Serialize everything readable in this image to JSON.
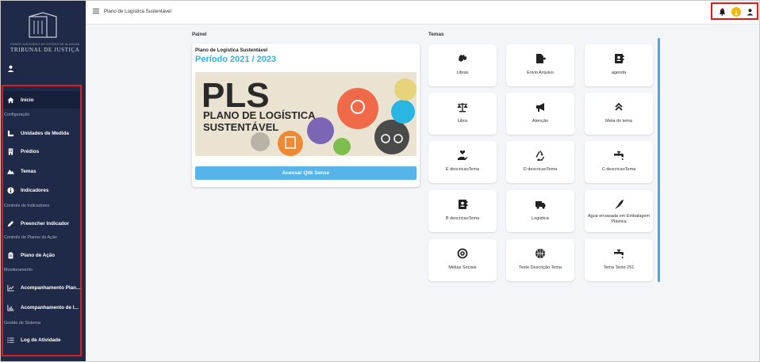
{
  "app": {
    "page_title": "Plano de Logística Sustentável"
  },
  "logo": {
    "subtitle": "PODER JUDICIÁRIO DO ESTADO DE ALAGOAS",
    "title": "TRIBUNAL DE JUSTIÇA"
  },
  "sidebar": {
    "items": [
      {
        "label": "Início",
        "icon": "home-icon"
      },
      {
        "section": "Configuração"
      },
      {
        "label": "Unidades de Medida",
        "icon": "ruler-icon"
      },
      {
        "label": "Prédios",
        "icon": "building-icon"
      },
      {
        "label": "Temas",
        "icon": "mountain-icon"
      },
      {
        "label": "Indicadores",
        "icon": "info-icon"
      },
      {
        "section": "Controle de Indicadores"
      },
      {
        "label": "Preencher Indicador",
        "icon": "pencil-icon"
      },
      {
        "section": "Controle de Planos de Ação"
      },
      {
        "label": "Plano de Ação",
        "icon": "clipboard-icon"
      },
      {
        "section": "Monitoramento"
      },
      {
        "label": "Acompanhamento Plan...",
        "icon": "line-chart-icon"
      },
      {
        "label": "Acompanhamento de I...",
        "icon": "bar-chart-icon"
      },
      {
        "section": "Gestão de Sistema"
      },
      {
        "label": "Log de Atividade",
        "icon": "list-icon"
      }
    ]
  },
  "panel": {
    "heading": "Painel",
    "card_title": "Plano de Logística Sustentável",
    "period": "Período 2021 / 2023",
    "banner_big": "PLS",
    "banner_line1": "PLANO DE LOGÍSTICA",
    "banner_line2": "SUSTENTÁVEL",
    "button_label": "Acessar Qlik Sense"
  },
  "temas": {
    "heading": "Temas",
    "tiles": [
      {
        "label": "Libras",
        "icon": "sign-language-icon"
      },
      {
        "label": "Envio Arquivo",
        "icon": "file-export-icon"
      },
      {
        "label": "agenda",
        "icon": "address-book-icon"
      },
      {
        "label": "Libra",
        "icon": "balance-scale-icon"
      },
      {
        "label": "Atenção",
        "icon": "megaphone-icon"
      },
      {
        "label": "Meta do tema",
        "icon": "double-chevron-up-icon"
      },
      {
        "label": "E descricaoTema",
        "icon": "hand-holding-heart-icon"
      },
      {
        "label": "D descricaoTema",
        "icon": "recycle-icon"
      },
      {
        "label": "C descricaoTema",
        "icon": "faucet-icon"
      },
      {
        "label": "B descricaoTema",
        "icon": "address-book-icon"
      },
      {
        "label": "Logistica",
        "icon": "truck-icon"
      },
      {
        "label": "Agua envasada em Embalagem Plástica",
        "icon": "feather-icon"
      },
      {
        "label": "Midias Sociais",
        "icon": "at-sign-icon"
      },
      {
        "label": "Teste Descrição Tema",
        "icon": "basketball-icon"
      },
      {
        "label": "Tema Teste 251",
        "icon": "faucet-icon"
      }
    ]
  },
  "colors": {
    "sidebar_bg": "#1e2a47",
    "accent": "#2ab6e3",
    "button": "#56b4e9",
    "highlight": "#e01b1b",
    "coin": "#f5b400"
  }
}
